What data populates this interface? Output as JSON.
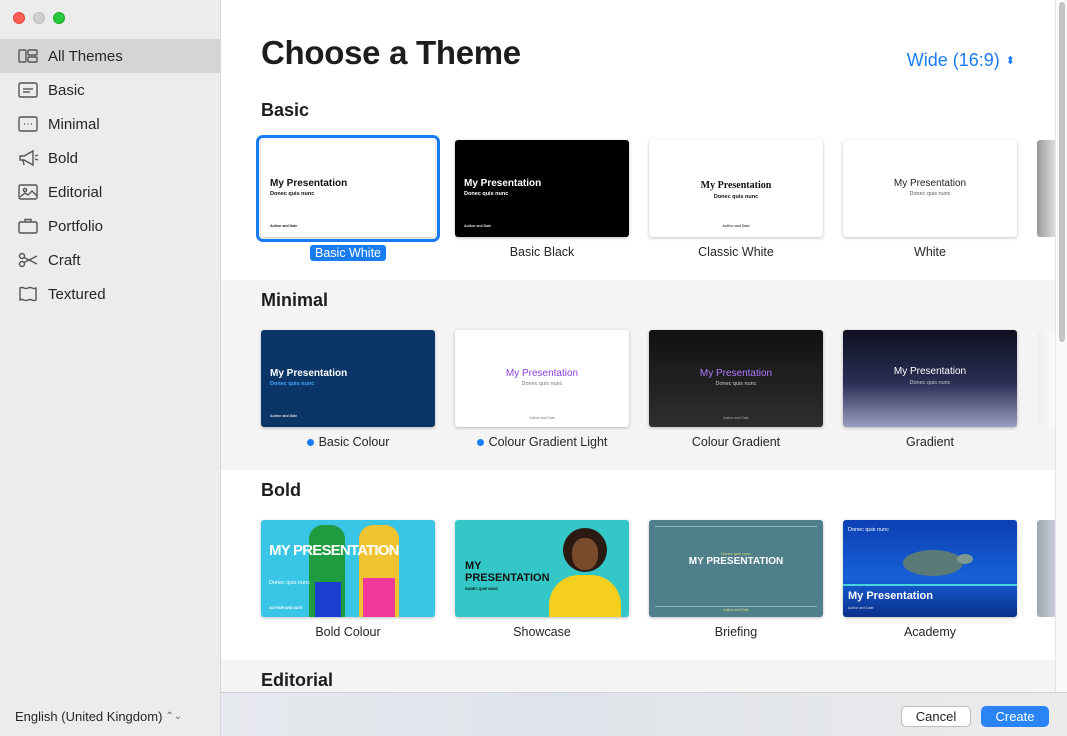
{
  "window": {
    "controls": [
      "close",
      "minimize",
      "maximize"
    ]
  },
  "sidebar": {
    "items": [
      {
        "label": "All Themes",
        "icon": "all-themes-icon",
        "active": true
      },
      {
        "label": "Basic",
        "icon": "basic-icon"
      },
      {
        "label": "Minimal",
        "icon": "minimal-icon"
      },
      {
        "label": "Bold",
        "icon": "megaphone-icon"
      },
      {
        "label": "Editorial",
        "icon": "image-icon"
      },
      {
        "label": "Portfolio",
        "icon": "briefcase-icon"
      },
      {
        "label": "Craft",
        "icon": "scissors-icon"
      },
      {
        "label": "Textured",
        "icon": "textured-icon"
      }
    ],
    "language": "English (United Kingdom)"
  },
  "main": {
    "title": "Choose a Theme",
    "aspect_ratio": "Wide (16:9)",
    "sections": [
      {
        "name": "Basic",
        "themes": [
          {
            "name": "Basic White",
            "selected": true,
            "card_title": "My Presentation",
            "card_sub": "Donec quis nunc",
            "card_foot": "Author and Date"
          },
          {
            "name": "Basic Black",
            "card_title": "My Presentation",
            "card_sub": "Donec quis nunc",
            "card_foot": "Author and Date"
          },
          {
            "name": "Classic White",
            "card_title": "My Presentation",
            "card_sub": "Donec quis nunc",
            "card_foot": "Author and Date"
          },
          {
            "name": "White",
            "card_title": "My Presentation",
            "card_sub": "Donec quis nunc"
          }
        ]
      },
      {
        "name": "Minimal",
        "themes": [
          {
            "name": "Basic Colour",
            "new": true,
            "card_title": "My Presentation",
            "card_sub": "Donec quis nunc",
            "card_foot": "Author and Date"
          },
          {
            "name": "Colour Gradient Light",
            "new": true,
            "card_title": "My Presentation",
            "card_sub": "Donec quis nunc",
            "card_foot": "Author and Date"
          },
          {
            "name": "Colour Gradient",
            "card_title": "My Presentation",
            "card_sub": "Donec quis nunc",
            "card_foot": "Author and Date"
          },
          {
            "name": "Gradient",
            "card_title": "My Presentation",
            "card_sub": "Donec quis nunc"
          }
        ]
      },
      {
        "name": "Bold",
        "themes": [
          {
            "name": "Bold Colour",
            "card_title": "MY PRESENTATION",
            "card_sub": "Donec quis nunc",
            "card_foot": "AUTHOR AND DATE"
          },
          {
            "name": "Showcase",
            "card_title": "MY PRESENTATION",
            "card_sub": "DONEC QUIS NUNC"
          },
          {
            "name": "Briefing",
            "card_title": "MY PRESENTATION",
            "card_sub": "Donec quis nunc",
            "card_foot": "Author and Date"
          },
          {
            "name": "Academy",
            "card_title": "My Presentation",
            "card_sub": "Donec quis nunc",
            "card_foot": "Author and Date"
          }
        ]
      },
      {
        "name": "Editorial"
      }
    ]
  },
  "footer": {
    "cancel_label": "Cancel",
    "create_label": "Create"
  },
  "colors": {
    "accent": "#1a7cf2",
    "sidebar_bg": "#ececec",
    "section_alt_bg": "#f4f4f4"
  }
}
